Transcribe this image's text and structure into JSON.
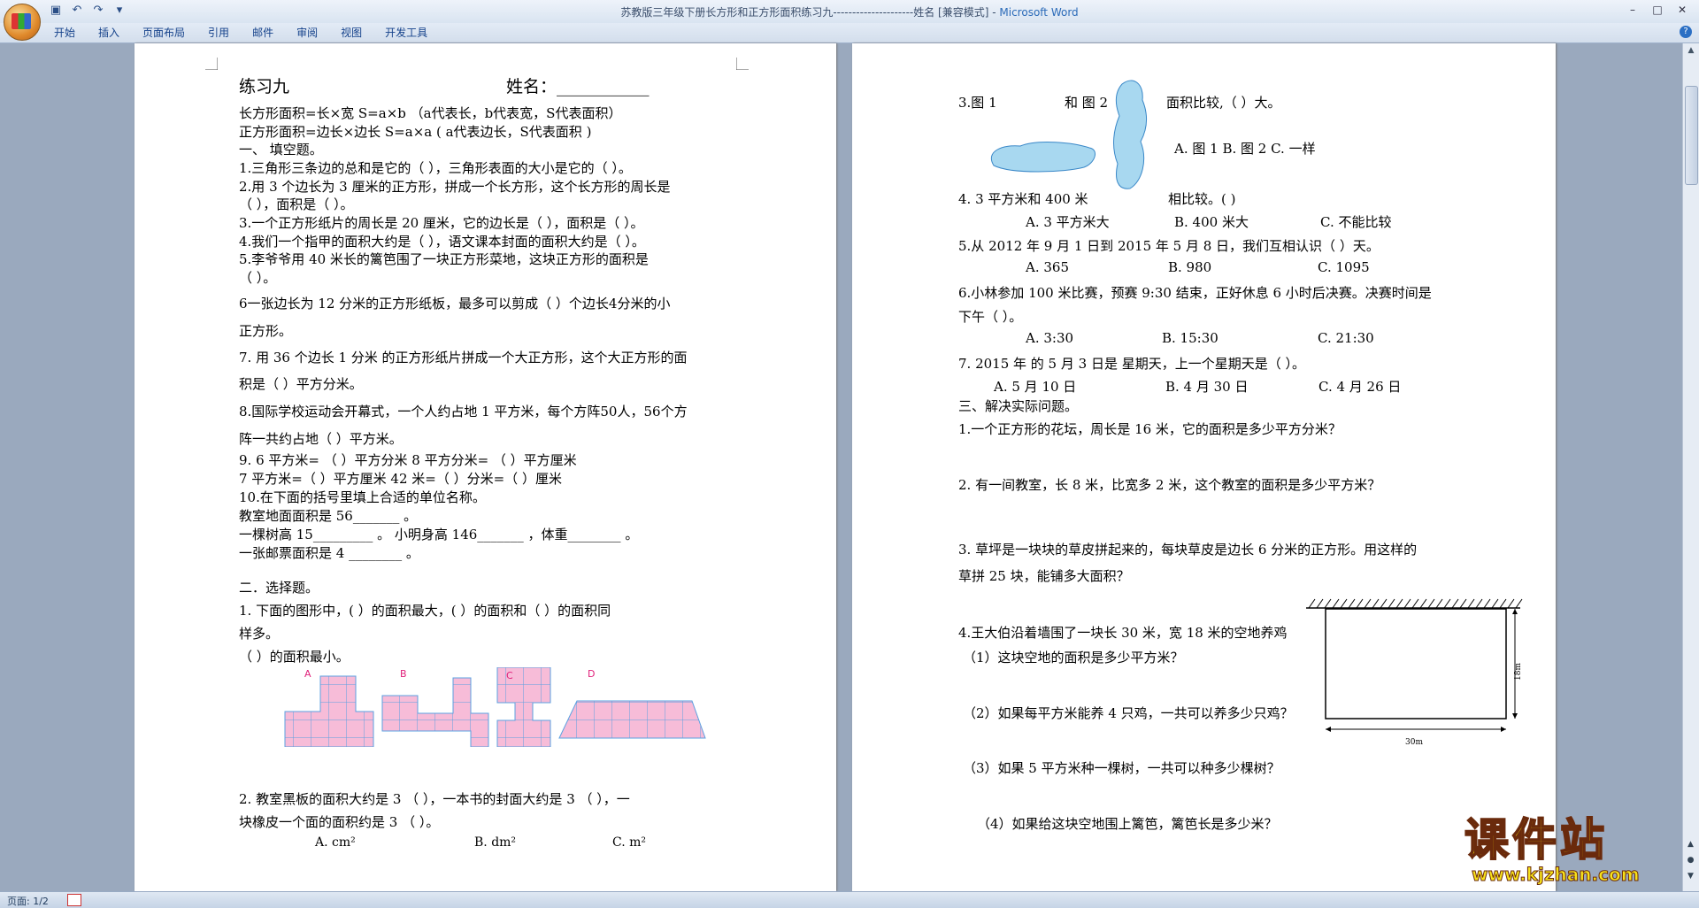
{
  "window": {
    "title_doc": "苏教版三年级下册长方形和正方形面积练习九---------------------姓名 [兼容模式] - ",
    "title_app": "Microsoft Word",
    "minimize": "–",
    "maximize": "□",
    "close": "✕"
  },
  "ribbon": {
    "tabs": [
      "开始",
      "插入",
      "页面布局",
      "引用",
      "邮件",
      "审阅",
      "视图",
      "开发工具"
    ],
    "help": "?"
  },
  "page1": {
    "lines": [
      "练习九",
      "姓名：___________",
      "长方形面积=长×宽   S=a×b  （a代表长，b代表宽，S代表面积）",
      " 正方形面积=边长×边长   S=a×a   (  a代表边长，S代表面积 )",
      "一、   填空题。",
      "1.三角形三条边的总和是它的（        ），三角形表面的大小是它的（       ）。",
      "2.用  3 个边长为  3 厘米的正方形，拼成一个长方形，这个长方形的周长是",
      "（        ），面积是（          ）。",
      "3.一个正方形纸片的周长是 20 厘米，它的边长是（    ），面积是（       ）。",
      "4.我们一个指甲的面积大约是（       ），语文课本封面的面积大约是（       ）。",
      "5.李爷爷用  40  米长的篱笆围了一块正方形菜地，这块正方形的面积是",
      "（       ）。",
      "6一张边长为 12 分米的正方形纸板，最多可以剪成（      ）个边长4分米的小",
      "正方形。",
      "7. 用  36  个边长  1  分米  的正方形纸片拼成一个大正方形，这个大正方形的面",
      "积是（      ）平方分米。",
      "8.国际学校运动会开幕式，一个人约占地   1 平方米，每个方阵50人，56个方",
      "阵一共约占地（       ）平方米。",
      "9.      6 平方米=  （          ）平方分米      8 平方分米=  （          ）平方厘米",
      "7 平方米=（          ）平方厘米         42 米=（       ）分米=（      ）厘米",
      "10.在下面的括号里填上合适的单位名称。",
      "教室地面面积是 56_______  。",
      "一棵树高 15_________  。                   小明身高 146_______ ，体重________ 。",
      "一张邮票面积是 4 ________ 。",
      "二．选择题。",
      "1. 下面的图形中，(       ）的面积最大，(      ）的面积和（        ）的面积同",
      "样多。",
      "（      ）的面积最小。",
      "2.   教室黑板的面积大约是  3  （      ），一本书的封面大约是  3  （     ），一",
      "块橡皮一个面的面积约是 3  （      ）。",
      "A. cm²",
      "B. dm²",
      "C. m²"
    ],
    "figure_labels": [
      "A",
      "B",
      "C",
      "D"
    ]
  },
  "page2": {
    "lines": [
      "3.图 1",
      "和 图 2",
      "面积比较,（        ）大。",
      "A. 图 1      B. 图 2    C. 一样",
      "4. 3 平方米和 400 米",
      "相比较。(        )",
      "A.  3 平方米大",
      "B.  400 米大",
      "C.  不能比较",
      "5.从 2012 年 9 月 1 日到 2015 年 5 月 8 日，我们互相认识（        ）天。",
      "A.  365",
      "B.  980",
      "C.  1095",
      "6.小林参加 100 米比赛，预赛 9:30 结束，正好休息 6 小时后决赛。决赛时间是",
      "下午（   ）。",
      "A.  3:30",
      "B.  15:30",
      "C.  21:30",
      "7. 2015 年  的  5  月  3 日是  星期天，上一个星期天是（       ）。",
      "A.  5 月 10 日",
      "B.  4 月 30 日",
      "C.  4 月 26 日",
      "三、解决实际问题。",
      "1.一个正方形的花坛，周长是 16 米，它的面积是多少平方分米？",
      "2. 有一间教室，长 8 米，比宽多 2 米，这个教室的面积是多少平方米？",
      "3. 草坪是一块块的草皮拼起来的，每块草皮是边长 6 分米的正方形。用这样的",
      "草拼 25 块，能铺多大面积？",
      "4.王大伯沿着墙围了一块长 30 米，宽 18 米的空地养鸡",
      "（1）这块空地的面积是多少平方米？",
      "（2）如果每平方米能养 4 只鸡，一共可以养多少只鸡？",
      "（3）如果 5 平方米种一棵树，一共可以种多少棵树？",
      "（4）如果给这块空地围上篱笆，篱笆长是多少米？"
    ],
    "dim_30": "30m",
    "dim_18": "18m"
  },
  "status": {
    "page": "页面: 1/2"
  },
  "watermark": {
    "main": "课件站",
    "url": "www.kjzhan.com"
  },
  "colors": {
    "grid_fill": "#f7bcd8",
    "grid_line": "#5ba0e0",
    "shape_fill": "#a8d8f0",
    "label_pink": "#e0207a",
    "watermark": "#f5d90a"
  }
}
